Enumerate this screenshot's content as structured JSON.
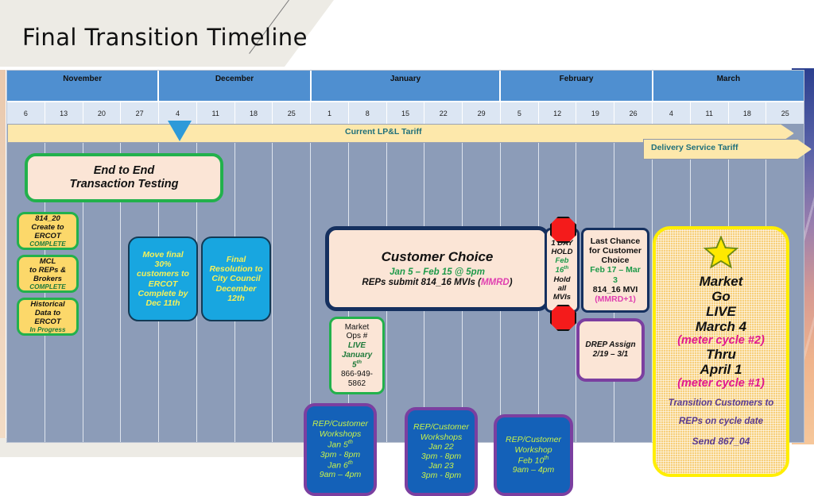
{
  "slide": {
    "title": "Final Transition Timeline"
  },
  "timeline": {
    "months": [
      {
        "label": "November",
        "weeks": 4
      },
      {
        "label": "December",
        "weeks": 4
      },
      {
        "label": "January",
        "weeks": 5
      },
      {
        "label": "February",
        "weeks": 4
      },
      {
        "label": "March",
        "weeks": 4
      }
    ],
    "weeks": [
      "6",
      "13",
      "20",
      "27",
      "4",
      "11",
      "18",
      "25",
      "1",
      "8",
      "15",
      "22",
      "29",
      "5",
      "12",
      "19",
      "26",
      "4",
      "11",
      "18",
      "25"
    ],
    "tariffs": {
      "current": "Current LP&L Tariff",
      "delivery": "Delivery Service Tariff"
    },
    "marker_icon": "current-date-triangle-marker"
  },
  "boxes": {
    "end_to_end": {
      "line1": "End to End",
      "line2": "Transaction Testing"
    },
    "status_items": [
      {
        "line1": "814_20",
        "line2": "Create to",
        "line3": "ERCOT",
        "status": "COMPLETE"
      },
      {
        "line1": "MCL",
        "line2": "to REPs &",
        "line3": "Brokers",
        "status": "COMPLETE"
      },
      {
        "line1": "Historical",
        "line2": "Data to",
        "line3": "ERCOT",
        "status": "In Progress"
      }
    ],
    "cyan_boxes": [
      {
        "lines": [
          "Move final",
          "30%",
          "customers to",
          "ERCOT",
          "Complete by",
          "Dec 11th"
        ]
      },
      {
        "lines": [
          "Final",
          "Resolution to",
          "City Council",
          "December",
          "12th"
        ]
      }
    ],
    "customer_choice": {
      "title": "Customer Choice",
      "dates": "Jan 5 – Feb 15 @ 5pm",
      "detail_prefix": "REPs submit 814_16 MVIs (",
      "detail_tag": "MMRD",
      "detail_suffix": ")"
    },
    "one_day_hold": {
      "line1": "1 DAY",
      "line2": "HOLD",
      "line3": "Feb",
      "line4": "16",
      "line4_sup": "th",
      "line5": "Hold",
      "line6": "all",
      "line7": "MVIs",
      "stop_icon": "stop-sign-octagon"
    },
    "last_chance": {
      "line1": "Last Chance",
      "line2": "for Customer",
      "line3": "Choice",
      "line4": "Feb 17 – Mar",
      "line5": "3",
      "line6": "814_16 MVI",
      "line7": "(MMRD+1)"
    },
    "market_ops": {
      "line1": "Market",
      "line2": "Ops #",
      "line3": "LIVE",
      "line4": "January",
      "line5": "5",
      "line5_sup": "th",
      "line6": "866-949-",
      "line7": "5862"
    },
    "drep_assign": {
      "line1": "DREP Assign",
      "line2": "2/19 – 3/1"
    },
    "workshops": [
      {
        "lines": [
          {
            "text": "REP/Customer"
          },
          {
            "text": "Workshops"
          },
          {
            "text": "Jan 5",
            "sup": "th"
          },
          {
            "text": "3pm - 8pm"
          },
          {
            "text": "Jan 6",
            "sup": "th"
          },
          {
            "text": "9am – 4pm"
          }
        ]
      },
      {
        "lines": [
          {
            "text": "REP/Customer"
          },
          {
            "text": "Workshops"
          },
          {
            "text": "Jan 22"
          },
          {
            "text": "3pm - 8pm"
          },
          {
            "text": "Jan 23"
          },
          {
            "text": "3pm - 8pm"
          }
        ]
      },
      {
        "lines": [
          {
            "text": "REP/Customer"
          },
          {
            "text": "Workshop"
          },
          {
            "text": "Feb 10",
            "sup": "th"
          },
          {
            "text": "9am – 4pm"
          }
        ]
      }
    ],
    "market_go_live": {
      "star_icon": "star-icon",
      "line1": "Market",
      "line2": "Go",
      "line3": "LIVE",
      "line4": "March 4",
      "line5": "(meter cycle #2)",
      "line6": "Thru",
      "line7": "April 1",
      "line8": "(meter cycle #1)",
      "line9": "Transition Customers to",
      "line10": "REPs on cycle date",
      "line11": "Send 867_04"
    }
  },
  "colors": {
    "month_header": "#4f8fd0",
    "week_row": "#dce6f3",
    "grid": "#8c9cb8",
    "tariff_band": "#fde8ab",
    "green_border": "#22b14c",
    "cyan_box": "#18a6e0",
    "workshop_box": "#1461b8",
    "purple_border": "#7b3fa0",
    "accent_pink": "#e0188f",
    "stop_red": "#f41b1b",
    "star_yellow": "#ffee00"
  }
}
